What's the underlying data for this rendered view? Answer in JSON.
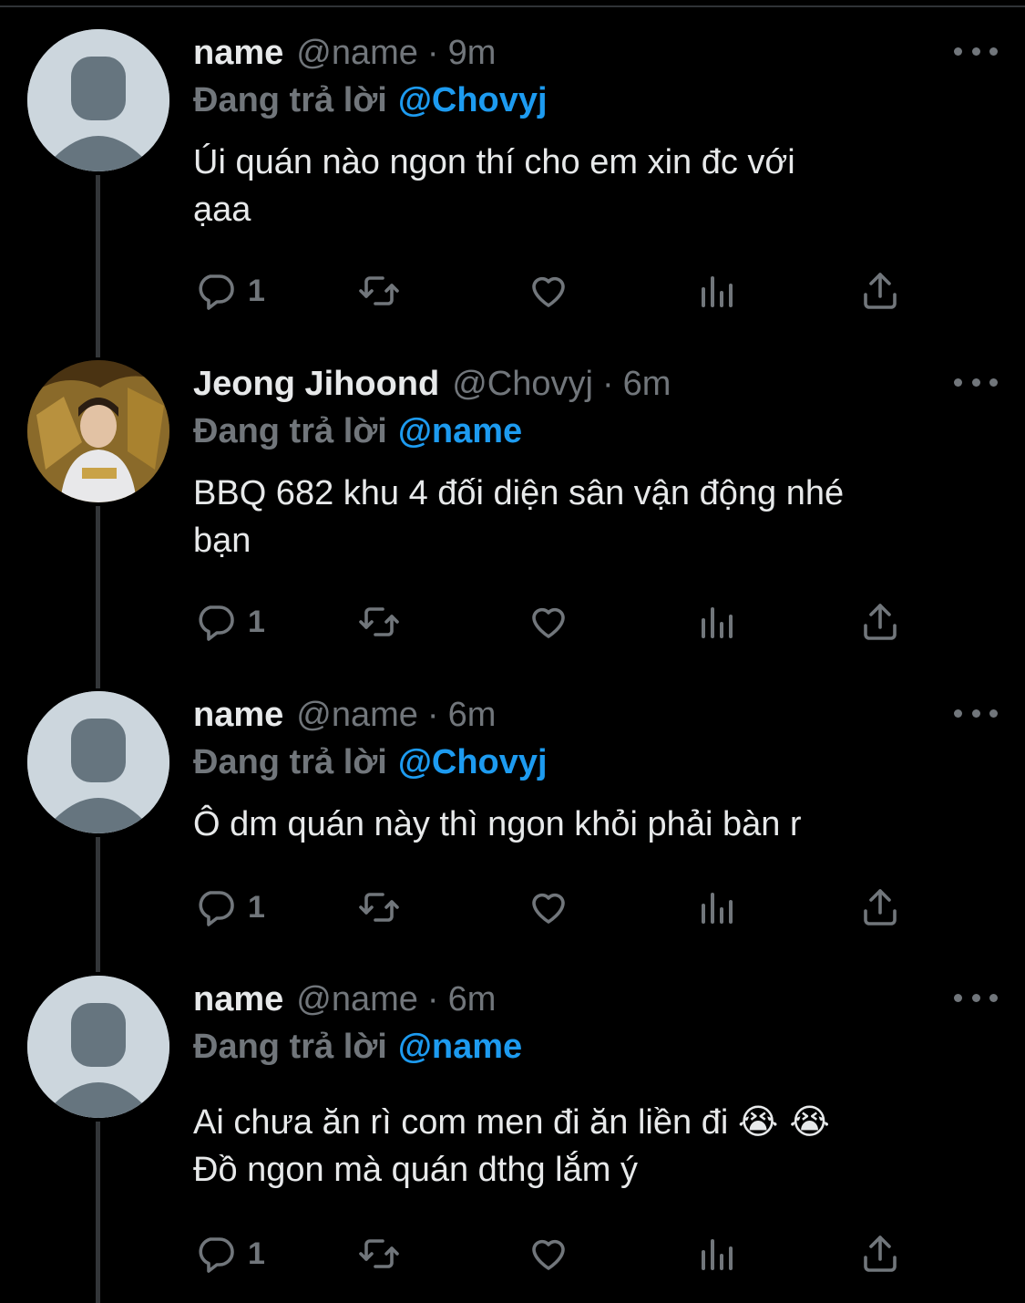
{
  "reply_prefix": "Đang trả lời",
  "tweets": [
    {
      "display_name": "name",
      "handle": "@name",
      "time": "9m",
      "reply_to": "@Chovyj",
      "text_lines": [
        "Úi quán nào ngon thí cho em xin đc với",
        "ạaa"
      ],
      "reply_count": "1"
    },
    {
      "display_name": "Jeong Jihoond",
      "handle": "@Chovyj",
      "time": "6m",
      "reply_to": "@name",
      "text_lines": [
        "BBQ 682 khu 4 đối diện sân vận động nhé",
        "bạn"
      ],
      "reply_count": "1"
    },
    {
      "display_name": "name",
      "handle": "@name",
      "time": "6m",
      "reply_to": "@Chovyj",
      "text_lines": [
        "Ô dm quán này thì ngon khỏi phải bàn r"
      ],
      "reply_count": "1"
    },
    {
      "display_name": "name",
      "handle": "@name",
      "time": "6m",
      "reply_to": "@name",
      "text_lines": [
        "Ai chưa ăn rì com men đi ăn liền đi",
        "Đồ ngon mà quán dthg lắm ý"
      ],
      "emoji": "😭 😭",
      "reply_count": "1"
    }
  ],
  "colors": {
    "background": "#000000",
    "text": "#e7e9ea",
    "secondary": "#71767b",
    "link": "#1d9bf0"
  }
}
